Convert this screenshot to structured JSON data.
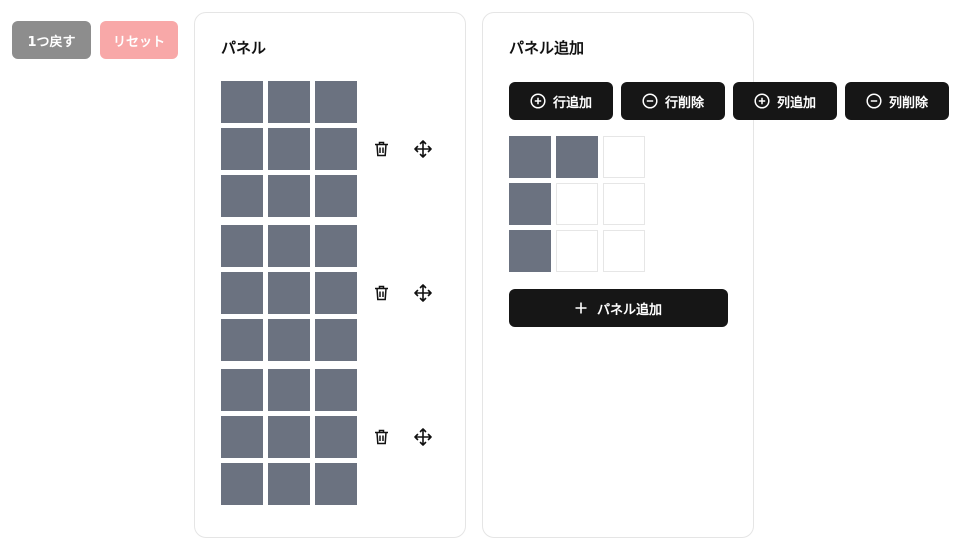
{
  "toolbar": {
    "undo_label": "1つ戻す",
    "reset_label": "リセット"
  },
  "panels_card": {
    "title": "パネル",
    "panels": [
      {
        "cells": [
          [
            1,
            1,
            1
          ],
          [
            1,
            1,
            1
          ],
          [
            1,
            1,
            1
          ]
        ],
        "delete_icon": "trash-icon",
        "move_icon": "move-icon"
      },
      {
        "cells": [
          [
            1,
            1,
            1
          ],
          [
            1,
            1,
            1
          ],
          [
            1,
            1,
            1
          ]
        ],
        "delete_icon": "trash-icon",
        "move_icon": "move-icon"
      },
      {
        "cells": [
          [
            1,
            1,
            1
          ],
          [
            1,
            1,
            1
          ],
          [
            1,
            1,
            1
          ]
        ],
        "delete_icon": "trash-icon",
        "move_icon": "move-icon"
      }
    ]
  },
  "add_card": {
    "title": "パネル追加",
    "buttons": {
      "add_row": {
        "label": "行追加",
        "icon": "plus-circle-icon"
      },
      "remove_row": {
        "label": "行削除",
        "icon": "minus-circle-icon"
      },
      "add_col": {
        "label": "列追加",
        "icon": "plus-circle-icon"
      },
      "remove_col": {
        "label": "列削除",
        "icon": "minus-circle-icon"
      }
    },
    "editor_cells": [
      [
        1,
        1,
        0
      ],
      [
        1,
        0,
        0
      ],
      [
        1,
        0,
        0
      ]
    ],
    "add_panel": {
      "label": "パネル追加",
      "icon": "plus-icon"
    }
  },
  "colors": {
    "cell_filled": "#6b7280",
    "button_dark": "#161616",
    "undo_button": "#8d8d8d",
    "reset_button": "#f8a8a8"
  }
}
